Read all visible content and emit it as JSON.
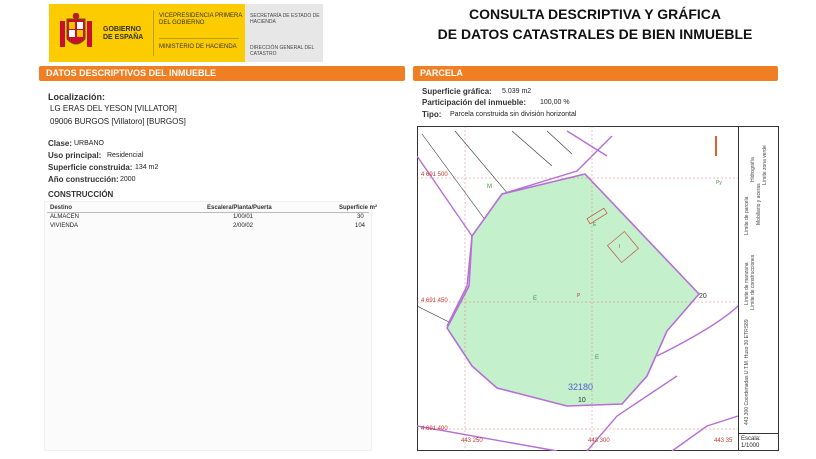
{
  "header": {
    "gov_name": "GOBIERNO DE ESPAÑA",
    "vicepresidencia": "VICEPRESIDENCIA PRIMERA DEL GOBIERNO",
    "ministerio": "MINISTERIO DE HACIENDA",
    "secretaria": "SECRETARÍA DE ESTADO DE HACIENDA",
    "direccion": "DIRECCIÓN GENERAL DEL CATASTRO",
    "title_line1": "CONSULTA DESCRIPTIVA Y GRÁFICA",
    "title_line2": "DE DATOS CATASTRALES DE BIEN INMUEBLE"
  },
  "inmueble": {
    "section_title": "DATOS DESCRIPTIVOS DEL INMUEBLE",
    "localizacion_label": "Localización:",
    "localizacion_line1": "LG ERAS DEL YESON [VILLATOR]",
    "localizacion_line2": "09006 BURGOS [Villatoro] [BURGOS]",
    "clase_label": "Clase:",
    "clase_value": "URBANO",
    "uso_label": "Uso principal:",
    "uso_value": "Residencial",
    "superficie_label": "Superficie construida:",
    "superficie_value": "134 m2",
    "anio_label": "Año construcción:",
    "anio_value": "2000"
  },
  "construccion": {
    "title": "CONSTRUCCIÓN",
    "headers": [
      "Destino",
      "Escalera/Planta/Puerta",
      "Superficie m²"
    ],
    "rows": [
      [
        "ALMACEN",
        "1/00/01",
        "30"
      ],
      [
        "VIVIENDA",
        "2/00/02",
        "104"
      ]
    ]
  },
  "parcela": {
    "section_title": "PARCELA",
    "superficie_label": "Superficie gráfica:",
    "superficie_value": "5.039 m2",
    "participacion_label": "Participación del inmueble:",
    "participacion_value": "100,00 %",
    "tipo_label": "Tipo:",
    "tipo_value": "Parcela construida sin división horizontal"
  },
  "map": {
    "coord_y1": "4 691 500",
    "coord_y2": "4 691 450",
    "coord_y3": "4 691 400",
    "coord_x1": "443 250",
    "coord_x2": "443 300",
    "coord_x3": "443 35",
    "parcel_number": "32180",
    "house_number_1": "10",
    "house_number_2": "20",
    "letter_m": "M",
    "letter_e1": "E",
    "letter_e2": "E",
    "letter_e3": "E",
    "letter_p": "P",
    "letter_i": "I",
    "letter_py": "Py",
    "scale_label": "Escala:",
    "scale_value": "1/1000",
    "legend_items": [
      "Límite de parcela",
      "Hidrografía",
      "Mobiliario y aceras",
      "Límite zona verde",
      "Límite de manzana",
      "Límite de construcciones"
    ],
    "utm_text": "443.300 Coordenadas U.T.M. Huso 30 ETRS89"
  },
  "colors": {
    "brand_orange": "#f07f23",
    "gov_yellow": "#fccc00",
    "parcel_fill": "#c5f0cc",
    "boundary_purple": "#b66fd6"
  }
}
